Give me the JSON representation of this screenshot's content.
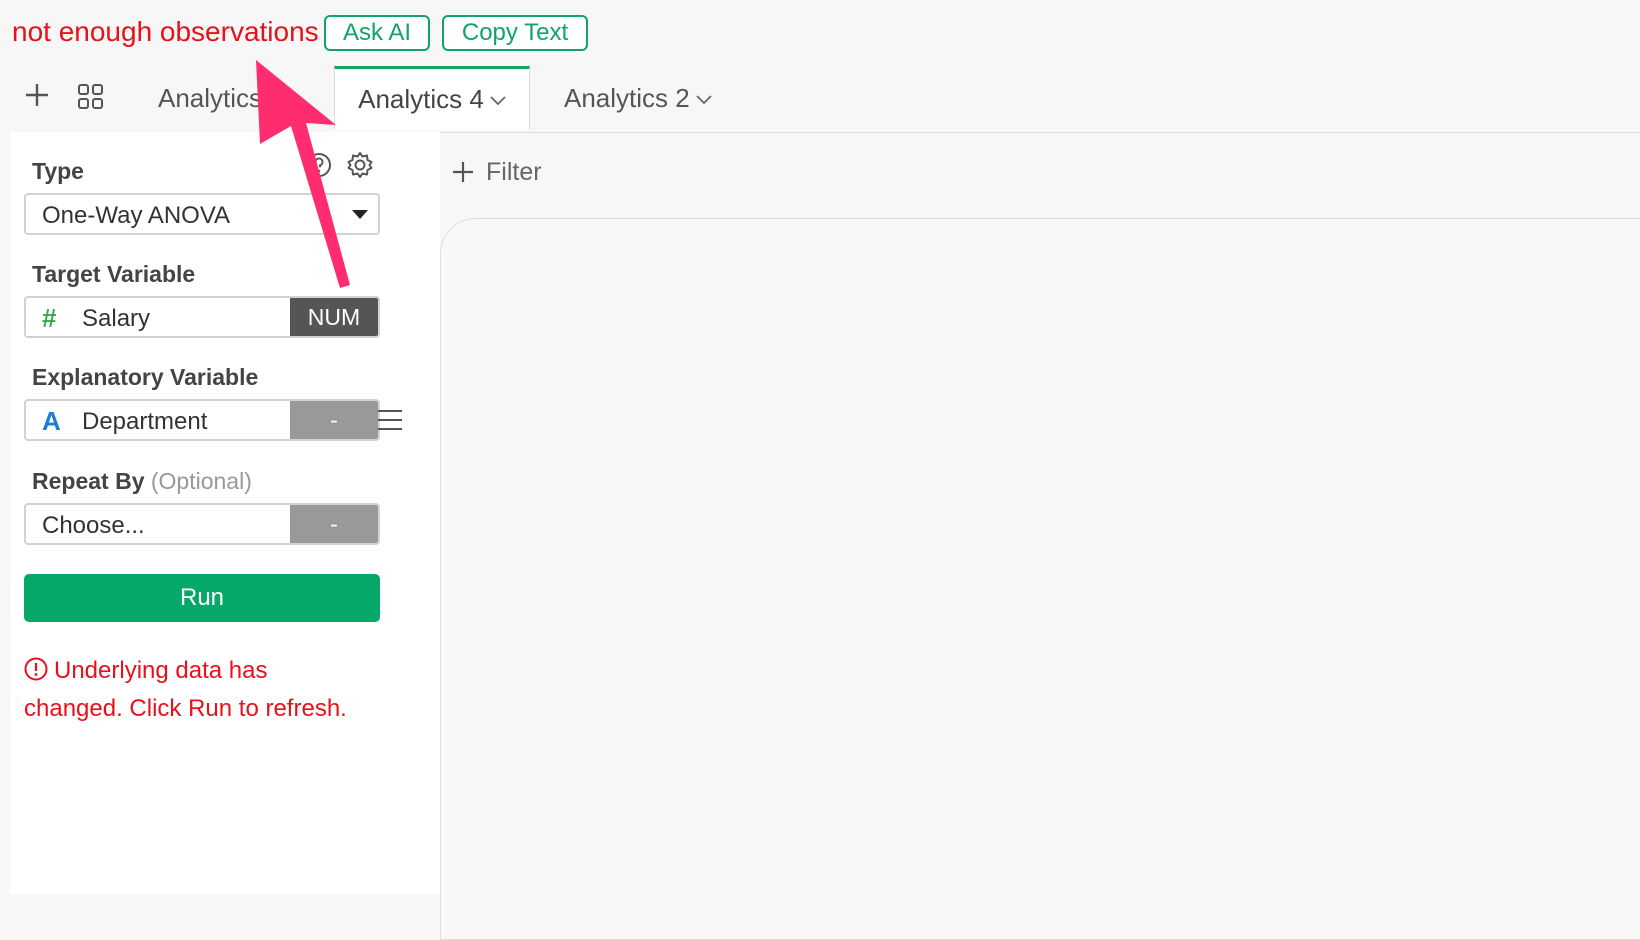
{
  "topbar": {
    "error_message": "not enough observations",
    "ask_ai_label": "Ask AI",
    "copy_text_label": "Copy Text"
  },
  "tabs": [
    {
      "label": "Analytics",
      "active": false
    },
    {
      "label": "Analytics 4",
      "active": true
    },
    {
      "label": "Analytics 2",
      "active": false
    }
  ],
  "panel": {
    "type_label": "Type",
    "type_value": "One-Way ANOVA",
    "target_label": "Target Variable",
    "target_icon": "#",
    "target_value": "Salary",
    "target_tag": "NUM",
    "explanatory_label": "Explanatory Variable",
    "explanatory_icon": "A",
    "explanatory_value": "Department",
    "explanatory_tag": "-",
    "repeat_label": "Repeat By",
    "repeat_optional": "(Optional)",
    "repeat_value": "Choose...",
    "repeat_tag": "-",
    "run_label": "Run",
    "warning_line1": "Underlying data has",
    "warning_line2": "changed. Click Run to refresh."
  },
  "filter_label": "Filter",
  "colors": {
    "accent": "#10a566",
    "error": "#e8101a",
    "arrow": "#ff2d6f",
    "num_icon": "#3aa84a",
    "str_icon": "#1a7fd4"
  },
  "icons": [
    "plus-icon",
    "grid-icon",
    "chevron-down-icon",
    "help-icon",
    "gear-icon",
    "menu-icon",
    "alert-icon"
  ]
}
